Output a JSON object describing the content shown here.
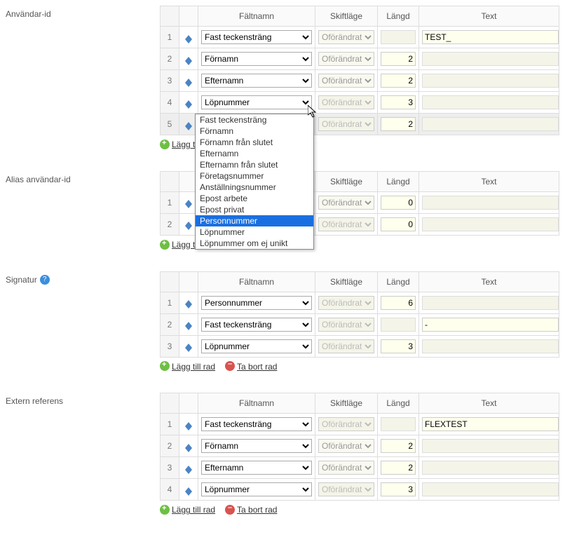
{
  "headers": {
    "field": "Fältnamn",
    "case": "Skiftläge",
    "length": "Längd",
    "text": "Text"
  },
  "actions": {
    "add_row": "Lägg till rad",
    "remove_row": "Ta bort rad"
  },
  "case_option": "Oförändrat",
  "dropdown_options": [
    "Fast teckensträng",
    "Förnamn",
    "Förnamn från slutet",
    "Efternamn",
    "Efternamn från slutet",
    "Företagsnummer",
    "Anställningsnummer",
    "Epost arbete",
    "Epost privat",
    "Personnummer",
    "Löpnummer",
    "Löpnummer om ej unikt"
  ],
  "dropdown_selected_index": 9,
  "sections": [
    {
      "key": "userid",
      "label": "Användar-id",
      "help": false,
      "rows": [
        {
          "num": "1",
          "field": "Fast teckensträng",
          "case": "Oförändrat",
          "length": "",
          "text": "TEST_",
          "len_disabled": true
        },
        {
          "num": "2",
          "field": "Förnamn",
          "case": "Oförändrat",
          "length": "2",
          "text": "",
          "txt_disabled": true
        },
        {
          "num": "3",
          "field": "Efternamn",
          "case": "Oförändrat",
          "length": "2",
          "text": "",
          "txt_disabled": true
        },
        {
          "num": "4",
          "field": "Löpnummer",
          "case": "Oförändrat",
          "length": "3",
          "text": "",
          "case_disabled": true,
          "txt_disabled": true
        },
        {
          "num": "5",
          "field": "Personnummer",
          "case": "Oförändrat",
          "length": "2",
          "text": "",
          "case_disabled": true,
          "txt_disabled": true,
          "selected": true
        }
      ]
    },
    {
      "key": "alias",
      "label": "Alias användar-id",
      "help": false,
      "rows": [
        {
          "num": "1",
          "field": "",
          "case": "Oförändrat",
          "length": "0",
          "text": "",
          "txt_disabled": true
        },
        {
          "num": "2",
          "field": "",
          "case": "Oförändrat",
          "length": "0",
          "text": "",
          "case_disabled": true,
          "txt_disabled": true
        }
      ]
    },
    {
      "key": "signatur",
      "label": "Signatur",
      "help": true,
      "rows": [
        {
          "num": "1",
          "field": "Personnummer",
          "case": "Oförändrat",
          "length": "6",
          "text": "",
          "case_disabled": true,
          "txt_disabled": true
        },
        {
          "num": "2",
          "field": "Fast teckensträng",
          "case": "Oförändrat",
          "length": "",
          "text": "-",
          "case_disabled": true,
          "len_disabled": true
        },
        {
          "num": "3",
          "field": "Löpnummer",
          "case": "Oförändrat",
          "length": "3",
          "text": "",
          "case_disabled": true,
          "txt_disabled": true
        }
      ]
    },
    {
      "key": "extern",
      "label": "Extern referens",
      "help": false,
      "rows": [
        {
          "num": "1",
          "field": "Fast teckensträng",
          "case": "Oförändrat",
          "length": "",
          "text": "FLEXTEST",
          "case_disabled": true,
          "len_disabled": true
        },
        {
          "num": "2",
          "field": "Förnamn",
          "case": "Oförändrat",
          "length": "2",
          "text": "",
          "txt_disabled": true
        },
        {
          "num": "3",
          "field": "Efternamn",
          "case": "Oförändrat",
          "length": "2",
          "text": "",
          "txt_disabled": true
        },
        {
          "num": "4",
          "field": "Löpnummer",
          "case": "Oförändrat",
          "length": "3",
          "text": "",
          "case_disabled": true,
          "txt_disabled": true
        }
      ]
    }
  ]
}
